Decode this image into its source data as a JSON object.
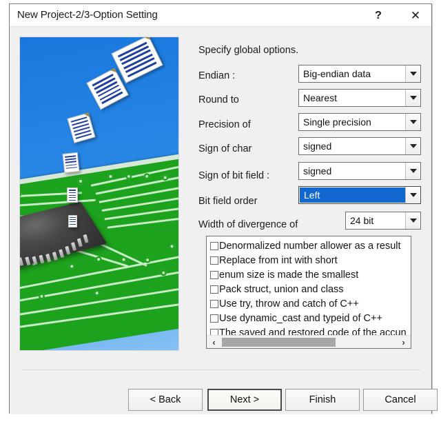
{
  "window": {
    "title": "New Project-2/3-Option Setting",
    "help_label": "?",
    "close_label": "✕"
  },
  "main": {
    "intro": "Specify global options.",
    "fields": [
      {
        "label": "Endian :",
        "value": "Big-endian data",
        "selected": false
      },
      {
        "label": "Round to",
        "value": "Nearest",
        "selected": false
      },
      {
        "label": "Precision of",
        "value": "Single precision",
        "selected": false
      },
      {
        "label": "Sign of char",
        "value": "signed",
        "selected": false
      },
      {
        "label": "Sign of bit field :",
        "value": "signed",
        "selected": false
      },
      {
        "label": "Bit field order",
        "value": "Left",
        "selected": true
      },
      {
        "label": "Width of divergence of",
        "value": "24 bit",
        "selected": false
      }
    ],
    "options_list": [
      "Denormalized number allower as a result",
      "Replace from int with short",
      "enum size is made the smallest",
      "Pack struct, union and class",
      "Use try, throw and catch of C++",
      "Use dynamic_cast and typeid of C++",
      "The saved and restored code of the accun"
    ],
    "scrollbar": {
      "left_arrow": "‹",
      "right_arrow": "›"
    }
  },
  "footer": {
    "buttons": [
      {
        "label": "< Back",
        "default": false
      },
      {
        "label": "Next >",
        "default": true
      },
      {
        "label": "Finish",
        "default": false
      },
      {
        "label": "Cancel",
        "default": false
      }
    ]
  },
  "colors": {
    "dialog_bg": "#f0f0f0",
    "selection_blue": "#1268cf",
    "pcb_green": "#1ca21c",
    "sky_blue": "#1878dd"
  }
}
